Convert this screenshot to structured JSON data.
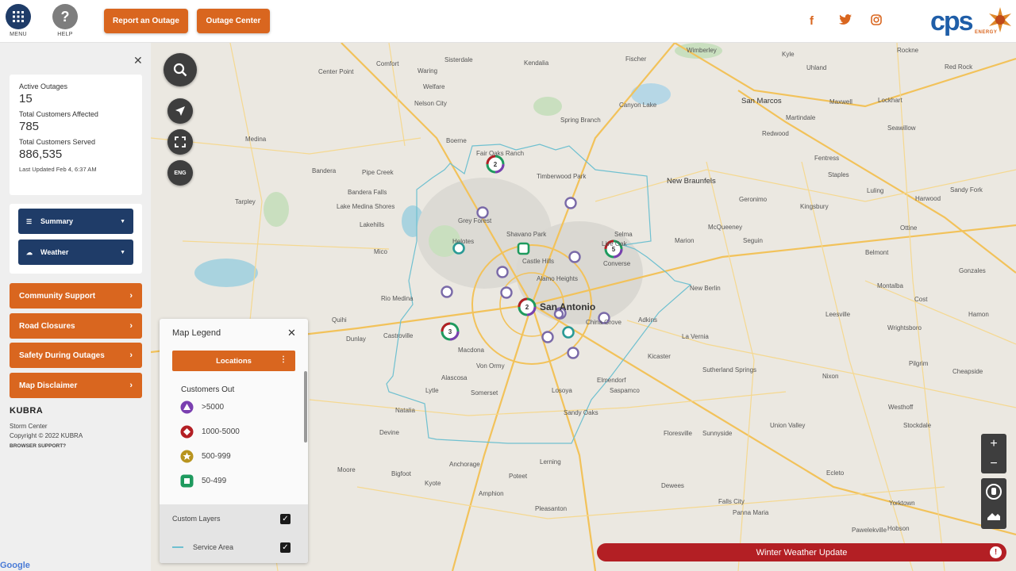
{
  "header": {
    "menu_label": "MENU",
    "help_label": "HELP",
    "report_outage": "Report an Outage",
    "outage_center": "Outage Center",
    "logo_text": "cps",
    "logo_sub": "ENERGY"
  },
  "panel": {
    "active_outages_label": "Active Outages",
    "active_outages": "15",
    "customers_affected_label": "Total Customers Affected",
    "customers_affected": "785",
    "customers_served_label": "Total Customers Served",
    "customers_served": "886,535",
    "last_updated": "Last Updated Feb 4, 6:37 AM",
    "summary": "Summary",
    "weather": "Weather",
    "menu_items": [
      "Community Support",
      "Road Closures",
      "Safety During Outages",
      "Map Disclaimer"
    ],
    "kubra": "KUBRA",
    "storm_center": "Storm Center",
    "copyright": "Copyright © 2022 KUBRA",
    "browser_support": "BROWSER SUPPORT?"
  },
  "map_controls": {
    "lang": "ENG"
  },
  "legend": {
    "title": "Map Legend",
    "locations": "Locations",
    "customers_out": "Customers Out",
    "items": [
      ">5000",
      "1000-5000",
      "500-999",
      "50-499"
    ],
    "custom_layers": "Custom Layers",
    "service_area": "Service Area"
  },
  "banner": {
    "text": "Winter Weather Update"
  },
  "map": {
    "places": [
      "Sisterdale",
      "Kendalia",
      "Fischer",
      "Wimberley",
      "Kyle",
      "Rockne",
      "Comfort",
      "Center Point",
      "Waring",
      "Welfare",
      "Uhland",
      "Red Rock",
      "Nelson City",
      "Canyon Lake",
      "San Marcos",
      "Maxwell",
      "Lockhart",
      "Spring Branch",
      "Martindale",
      "Medina",
      "Boerne",
      "Seawillow",
      "Redwood",
      "Pipe Creek",
      "Bandera",
      "Fair Oaks Ranch",
      "Timberwood Park",
      "Fentress",
      "Staples",
      "New Braunfels",
      "Bandera Falls",
      "Luling",
      "Harwood",
      "Sandy Fork",
      "Tarpley",
      "Lake Medina Shores",
      "Grey Forest",
      "Geronimo",
      "Kingsbury",
      "Lakehills",
      "Helotes",
      "Shavano Park",
      "Selma",
      "Mico",
      "Castle Hills",
      "Live Oak",
      "Converse",
      "Marion",
      "McQueeney",
      "Seguin",
      "Ottine",
      "Belmont",
      "Alamo Heights",
      "New Berlin",
      "Gonzales",
      "Rio Medina",
      "San Antonio",
      "Montalba",
      "Cost",
      "Quihi",
      "Dunlay",
      "Castroville",
      "China Grove",
      "Adkins",
      "La Vernia",
      "Leesville",
      "Wrightsboro",
      "Hamon",
      "Macdona",
      "Von Ormy",
      "Kicaster",
      "Pilgrim",
      "Alascosa",
      "Elmendorf",
      "Sutherland Springs",
      "Cheapside",
      "Lytle",
      "Somerset",
      "Losoya",
      "Sandy Oaks",
      "Saspamco",
      "Nixon",
      "Natalia",
      "Westhoff",
      "Devine",
      "Floresville",
      "Sunnyside",
      "Union Valley",
      "Stockdale",
      "Anchorage",
      "Lerning",
      "Moore",
      "Bigfoot",
      "Poteet",
      "Kyote",
      "Dewees",
      "Ecleto",
      "Amphion",
      "Pleasanton",
      "Falls City",
      "Yorktown",
      "Pawelekville",
      "Panna Maria",
      "Hobson",
      "Redwood",
      "Rio Medina"
    ],
    "clusters": [
      "2",
      "5",
      "2",
      "3"
    ]
  }
}
